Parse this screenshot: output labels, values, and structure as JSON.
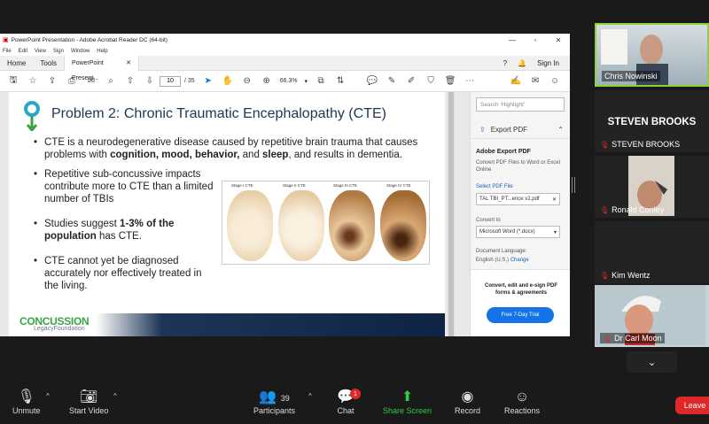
{
  "acrobat": {
    "window_title": "PowerPoint Presentation - Adobe Acrobat Reader DC (64-bit)",
    "menu": [
      "File",
      "Edit",
      "View",
      "Sign",
      "Window",
      "Help"
    ],
    "tabs": {
      "home": "Home",
      "tools": "Tools",
      "doc": "PowerPoint Present..."
    },
    "sign_in": "Sign In",
    "page_current": "10",
    "page_total": "/ 35",
    "zoom": "66.3%",
    "search_placeholder": "Search 'Highlight'",
    "export_pdf": "Export PDF",
    "panel": {
      "heading": "Adobe Export PDF",
      "desc": "Convert PDF Files to Word or Excel Online",
      "select_label": "Select PDF File",
      "file": "TAL TBI_PT...ence v2.pdf",
      "convert_to": "Convert to",
      "format": "Microsoft Word (*.docx)",
      "doc_lang_label": "Document Language:",
      "doc_lang": "English (U.S.)",
      "change": "Change",
      "promo": "Convert, edit and e-sign PDF forms & agreements",
      "trial": "Free 7-Day Trial"
    }
  },
  "slide": {
    "title": "Problem 2: Chronic Traumatic Encephalopathy (CTE)",
    "bullet1_pre": "CTE is a neurodegenerative disease caused by repetitive brain trauma that causes problems with ",
    "bullet1_bold": "cognition, mood, behavior,",
    "bullet1_mid": " and ",
    "bullet1_bold2": "sleep",
    "bullet1_post": ", and results in dementia.",
    "bullet2": "Repetitive sub-concussive impacts contribute more to CTE than a limited number of TBIs",
    "bullet3_pre": "Studies suggest ",
    "bullet3_bold": "1-3% of the population",
    "bullet3_post": " has CTE.",
    "bullet4": "CTE cannot yet be diagnosed accurately nor effectively treated in the living.",
    "stages": [
      "Stage I CTE",
      "Stage II CTE",
      "Stage III CTE",
      "Stage IV CTE"
    ],
    "logo_main": "CONCUSSION",
    "logo_sub": "LegacyFoundation"
  },
  "participants": {
    "p1": "Chris Nowinski",
    "p2_big": "STEVEN BROOKS",
    "p2": "STEVEN BROOKS",
    "p3": "Ronald Conley",
    "p4": "Kim Wentz",
    "p5": "Dr Carl Moon"
  },
  "controls": {
    "unmute": "Unmute",
    "start_video": "Start Video",
    "participants": "Participants",
    "participant_count": "39",
    "chat": "Chat",
    "chat_badge": "1",
    "share": "Share Screen",
    "record": "Record",
    "reactions": "Reactions",
    "leave": "Leave"
  },
  "colors": {
    "zoom_bg": "#1a1a1a",
    "leave": "#e02828",
    "share_green": "#2ecc40",
    "slide_navy": "#1d3557"
  }
}
